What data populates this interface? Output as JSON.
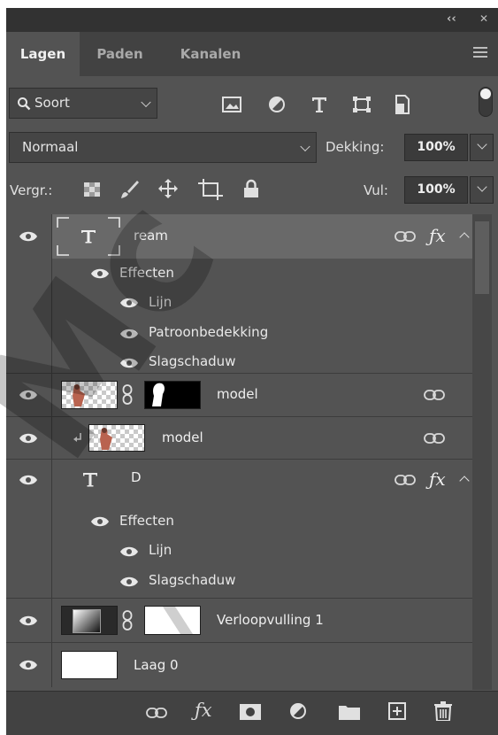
{
  "window": {
    "collapse_glyph": "‹‹",
    "close_glyph": "✕"
  },
  "tabs": [
    {
      "label": "Lagen",
      "active": true
    },
    {
      "label": "Paden",
      "active": false
    },
    {
      "label": "Kanalen",
      "active": false
    }
  ],
  "filter": {
    "kind_label": "Soort",
    "icons": [
      "image-filter-icon",
      "adjustment-filter-icon",
      "type-filter-icon",
      "shape-filter-icon",
      "smart-object-filter-icon"
    ],
    "toggle_on": true
  },
  "blend": {
    "mode": "Normaal",
    "opacity_label": "Dekking:",
    "opacity_value": "100%"
  },
  "lock": {
    "label": "Vergr.:",
    "icons": [
      "lock-transparency-icon",
      "lock-image-icon",
      "lock-position-icon",
      "lock-artboard-icon",
      "lock-all-icon"
    ],
    "fill_label": "Vul:",
    "fill_value": "100%"
  },
  "layers": [
    {
      "kind": "text",
      "name": "ream",
      "selected": true,
      "fx": true,
      "linked": true,
      "effects_label": "Effecten",
      "effects": [
        "Lijn",
        "Patroonbedekking",
        "Slagschaduw"
      ]
    },
    {
      "kind": "masked-image",
      "name": "model",
      "linked": true
    },
    {
      "kind": "clipped-image",
      "name": "model",
      "linked": true
    },
    {
      "kind": "text",
      "name": "D",
      "selected": false,
      "fx": true,
      "linked": true,
      "effects_label": "Effecten",
      "effects": [
        "Lijn",
        "Slagschaduw"
      ]
    },
    {
      "kind": "gradient-fill",
      "name": "Verloopvulling 1"
    },
    {
      "kind": "plain",
      "name": "Laag 0"
    }
  ],
  "footer_icons": [
    "link-layers-icon",
    "fx-icon",
    "add-mask-icon",
    "new-adjustment-icon",
    "new-group-icon",
    "new-layer-icon",
    "delete-layer-icon"
  ],
  "watermark": "Mc"
}
